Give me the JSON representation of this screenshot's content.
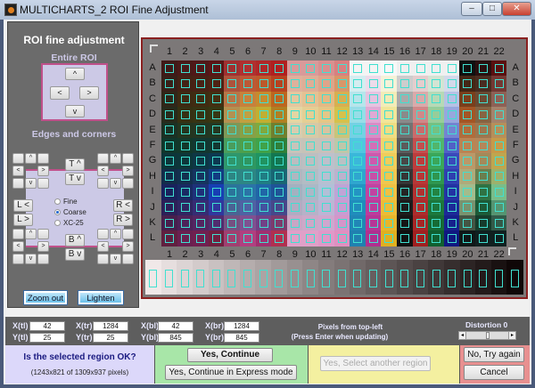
{
  "window": {
    "title": "MULTICHARTS_2 ROI Fine Adjustment",
    "min": "–",
    "max": "□",
    "close": "✕"
  },
  "left": {
    "title": "ROI fine adjustment",
    "entire_roi": "Entire ROI",
    "up": "^",
    "down": "v",
    "left": "<",
    "right": ">",
    "edges": "Edges and corners",
    "t_up": "T ^",
    "t_down": "T v",
    "b_up": "B ^",
    "b_down": "B v",
    "l_left": "L <",
    "l_right": "L >",
    "r_left": "R <",
    "r_right": "R >",
    "radio": [
      {
        "label": "Fine",
        "checked": false
      },
      {
        "label": "Coarse",
        "checked": true
      },
      {
        "label": "XC-25",
        "checked": false
      }
    ],
    "zoom_out": "Zoom out",
    "lighten": "Lighten"
  },
  "chart": {
    "columns": [
      "1",
      "2",
      "3",
      "4",
      "5",
      "6",
      "7",
      "8",
      "9",
      "10",
      "11",
      "12",
      "13",
      "14",
      "15",
      "16",
      "17",
      "18",
      "19",
      "20",
      "21",
      "22"
    ],
    "rows": [
      "A",
      "B",
      "C",
      "D",
      "E",
      "F",
      "G",
      "H",
      "I",
      "J",
      "K",
      "L"
    ],
    "accent_square": "#40e0d0"
  },
  "coords": {
    "xtl_label": "X(tl)",
    "xtl": "42",
    "ytl_label": "Y(tl)",
    "ytl": "25",
    "xtr_label": "X(tr)",
    "xtr": "1284",
    "ytr_label": "Y(tr)",
    "ytr": "25",
    "xbl_label": "X(bl)",
    "xbl": "42",
    "ybl_label": "Y(bl)",
    "ybl": "845",
    "xbr_label": "X(br)",
    "xbr": "1284",
    "ybr_label": "Y(br)",
    "ybr": "845",
    "note1": "Pixels from top-left",
    "note2": "(Press Enter when updating)",
    "distortion": "Distortion 0",
    "distortion_value": 0
  },
  "bottom": {
    "question": "Is the selected region OK?",
    "size": "(1243x821 of 1309x937 pixels)",
    "yes": "Yes, Continue",
    "express": "Yes, Continue in Express mode",
    "another": "Yes, Select another region",
    "no": "No, Try again",
    "cancel": "Cancel"
  }
}
